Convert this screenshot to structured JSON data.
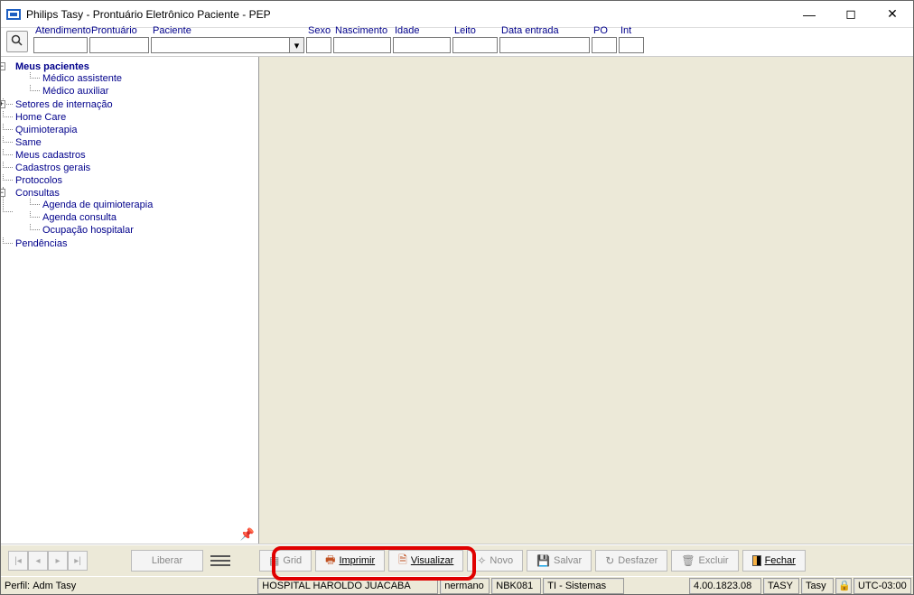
{
  "title": "Philips Tasy - Prontuário Eletrônico Paciente - PEP",
  "fields": {
    "atendimento": "Atendimento",
    "prontuario": "Prontuário",
    "paciente": "Paciente",
    "sexo": "Sexo",
    "nascimento": "Nascimento",
    "idade": "Idade",
    "leito": "Leito",
    "data_entrada": "Data entrada",
    "po": "PO",
    "int": "Int"
  },
  "tree": {
    "root": "Meus pacientes",
    "medico_assistente": "Médico assistente",
    "medico_auxiliar": "Médico auxiliar",
    "setores": "Setores de internação",
    "homecare": "Home Care",
    "quimio": "Quimioterapia",
    "same": "Same",
    "meus_cadastros": "Meus cadastros",
    "cadastros_gerais": "Cadastros gerais",
    "protocolos": "Protocolos",
    "consultas": "Consultas",
    "agenda_quimio": "Agenda de quimioterapia",
    "agenda_consulta": "Agenda consulta",
    "ocupacao": "Ocupação hospitalar",
    "pendencias": "Pendências"
  },
  "toolbar": {
    "liberar": "Liberar",
    "grid": "Grid",
    "imprimir": "Imprimir",
    "visualizar": "Visualizar",
    "novo": "Novo",
    "salvar": "Salvar",
    "desfazer": "Desfazer",
    "excluir": "Excluir",
    "fechar": "Fechar"
  },
  "status": {
    "perfil_label": "Perfil:",
    "perfil_value": "Adm Tasy",
    "hospital": "HOSPITAL HAROLDO JUACABA",
    "extra1": "nermano",
    "nbk": "NBK081",
    "ti": "TI - Sistemas",
    "version": "4.00.1823.08",
    "tasy": "TASY",
    "tasy2": "Tasy",
    "tz": "UTC-03:00"
  }
}
